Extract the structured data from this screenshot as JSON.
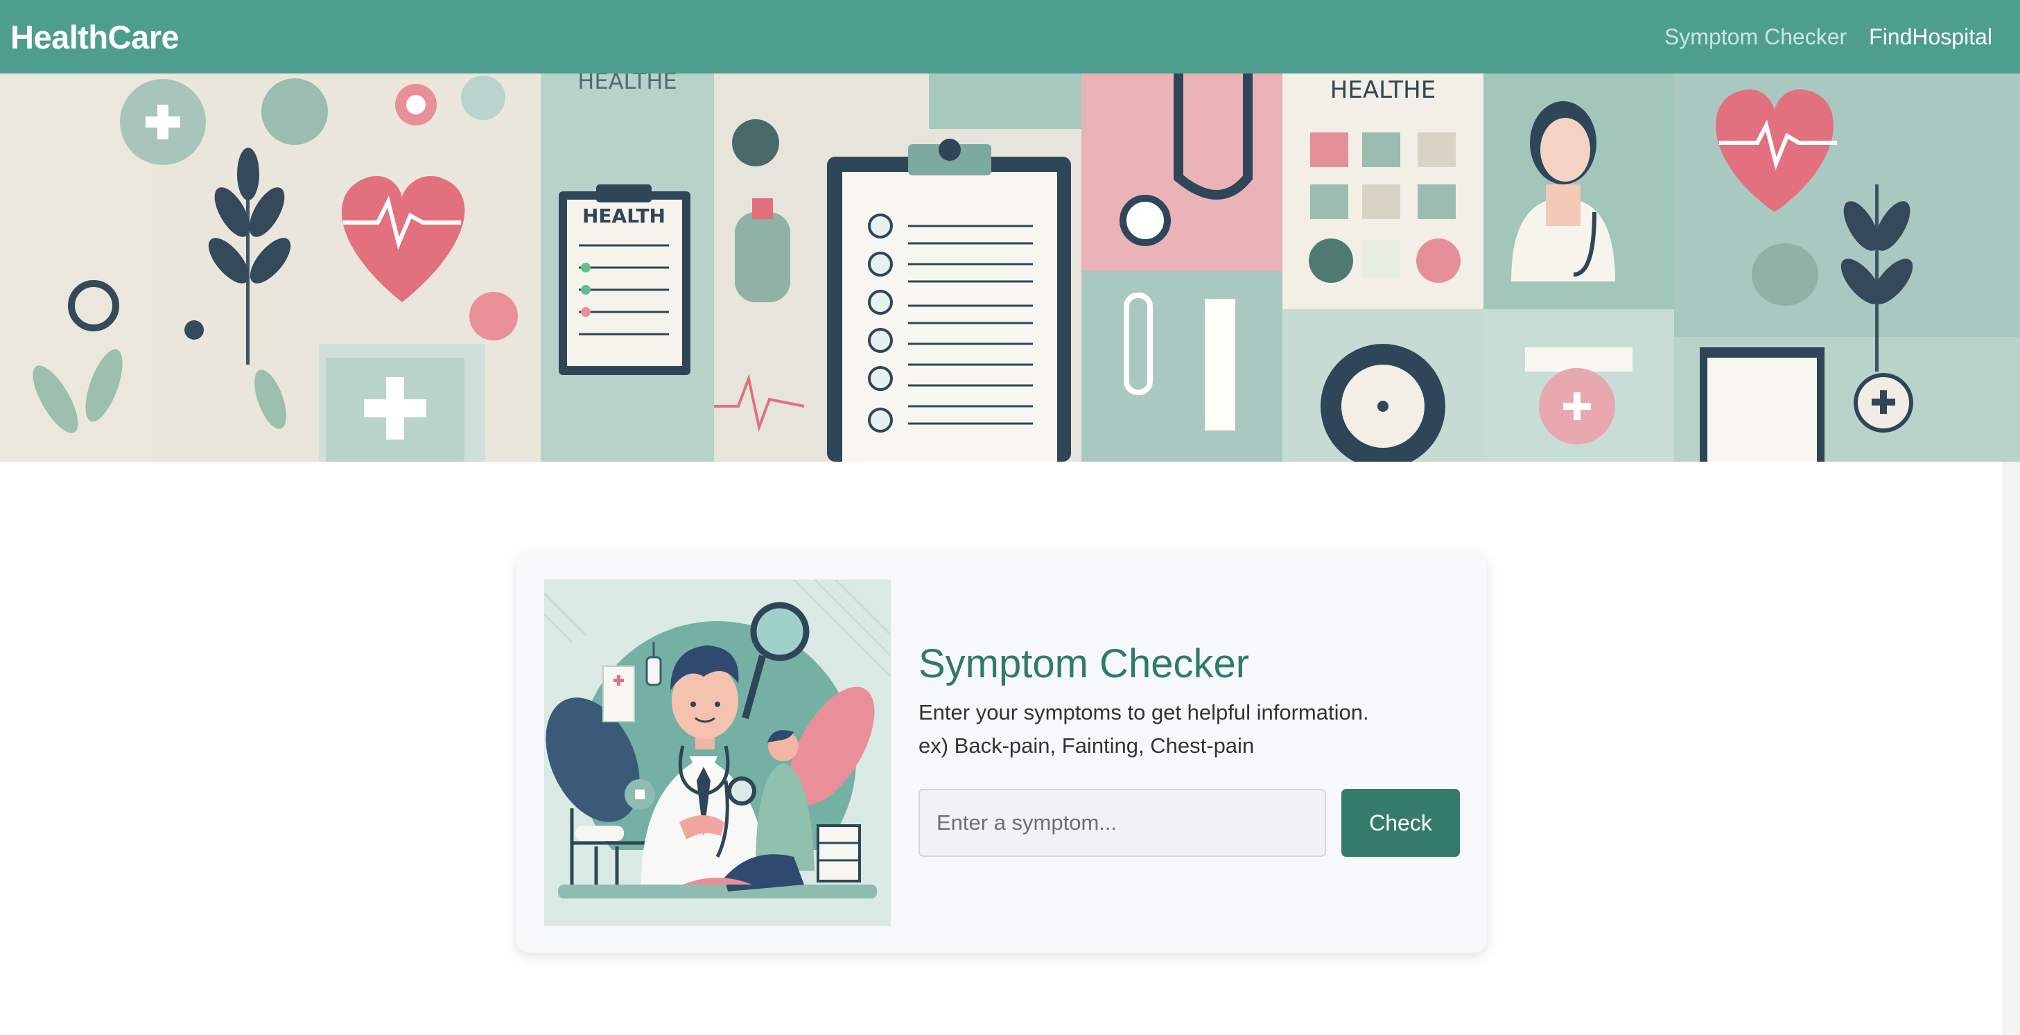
{
  "navbar": {
    "brand": "HealthCare",
    "links": [
      {
        "label": "Symptom Checker"
      },
      {
        "label": "FindHospital"
      }
    ]
  },
  "banner": {
    "panel_texts": [
      "HEALTHE",
      "HEALTH",
      "HEALTHE"
    ]
  },
  "card": {
    "title": "Symptom Checker",
    "description": "Enter your symptoms to get helpful information.",
    "example": "ex) Back-pain, Fainting, Chest-pain",
    "input_placeholder": "Enter a symptom...",
    "input_value": "",
    "check_label": "Check"
  },
  "colors": {
    "navbar": "#4e9e90",
    "accent": "#2f7a6a",
    "button": "#357b6b",
    "banner_teal": "#a9c9c0",
    "banner_pink": "#e8a5ad",
    "banner_navy": "#2e4657"
  },
  "icons": [
    "plus-icon",
    "heart-icon",
    "clipboard-icon",
    "stethoscope-icon",
    "doctor-icon",
    "leaf-icon",
    "magnifier-icon"
  ]
}
